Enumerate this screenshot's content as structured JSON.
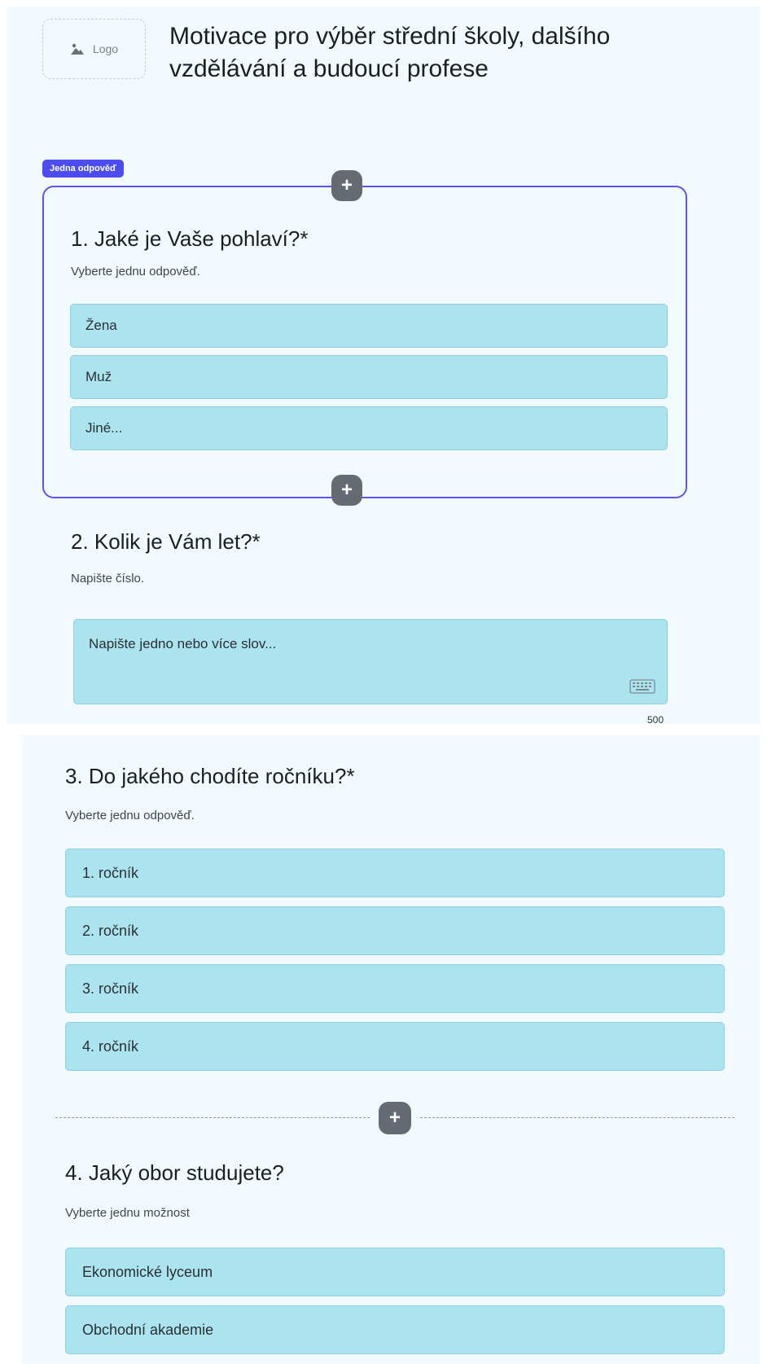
{
  "header": {
    "logo_label": "Logo",
    "title": "Motivace pro výběr střední školy, dalšího vzdělávání a budoucí profese"
  },
  "badge": {
    "label": "Jedna odpověď"
  },
  "add_label": "+",
  "q1": {
    "title": "1. Jaké je Vaše pohlaví?*",
    "hint": "Vyberte jednu odpověď.",
    "options": [
      "Žena",
      "Muž",
      "Jiné..."
    ]
  },
  "q2": {
    "title": "2. Kolik je Vám let?*",
    "hint": "Napište číslo.",
    "placeholder": "Napište jedno nebo více slov...",
    "char_limit": "500"
  },
  "q3": {
    "title": "3. Do jakého chodíte ročníku?*",
    "hint": "Vyberte jednu odpověď.",
    "options": [
      "1. ročník",
      "2. ročník",
      "3. ročník",
      "4. ročník"
    ]
  },
  "q4": {
    "title": "4. Jaký obor studujete?",
    "hint": "Vyberte jednu možnost",
    "options": [
      "Ekonomické lyceum",
      "Obchodní akademie"
    ]
  },
  "colors": {
    "accent": "#5a55f0",
    "badge": "#4c4cf1",
    "option_fill": "#abe3ef",
    "panel_bg": "#f2fafd",
    "add_button": "#666a73"
  },
  "icons": {
    "logo": "image-icon",
    "add": "plus-icon",
    "keyboard": "keyboard-icon"
  }
}
